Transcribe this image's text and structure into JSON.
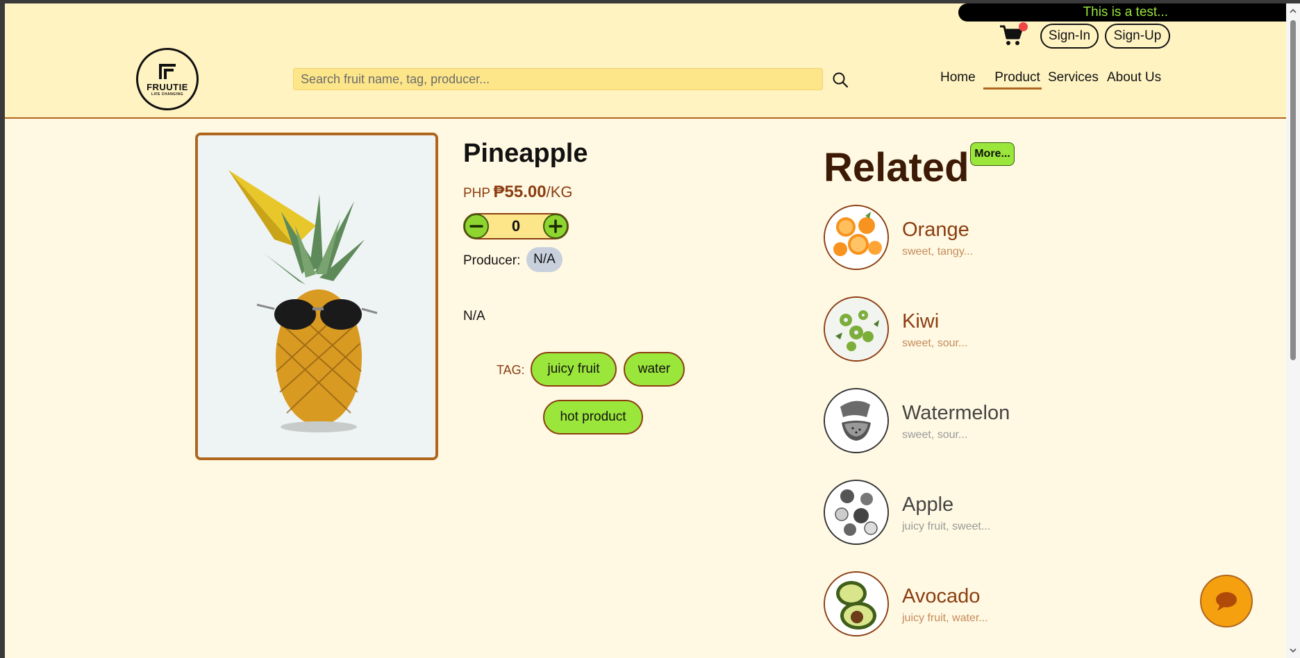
{
  "ticker": {
    "text": "This is a test..."
  },
  "header": {
    "signin_label": "Sign-In",
    "signup_label": "Sign-Up",
    "logo": {
      "name": "FRUUTIE",
      "tagline": "LIFE CHANGING"
    },
    "search": {
      "placeholder": "Search fruit name, tag, producer...",
      "value": ""
    },
    "nav": [
      {
        "label": "Home",
        "active": false
      },
      {
        "label": "Product",
        "active": true
      },
      {
        "label": "Services",
        "active": false
      },
      {
        "label": "About Us",
        "active": false
      }
    ]
  },
  "product": {
    "name": "Pineapple",
    "price_prefix": "PHP",
    "price": "₱55.00",
    "unit": "/KG",
    "quantity": "0",
    "producer_label": "Producer:",
    "producer": "N/A",
    "description": "N/A",
    "tag_label": "TAG:",
    "tags": [
      "juicy fruit",
      "water",
      "hot product"
    ]
  },
  "related": {
    "title": "Related",
    "more_label": "More...",
    "items": [
      {
        "name": "Orange",
        "tags": "sweet, tangy..."
      },
      {
        "name": "Kiwi",
        "tags": "sweet, sour..."
      },
      {
        "name": "Watermelon",
        "tags": "sweet, sour..."
      },
      {
        "name": "Apple",
        "tags": "juicy fruit, sweet..."
      },
      {
        "name": "Avocado",
        "tags": "juicy fruit, water..."
      }
    ]
  },
  "colors": {
    "header_bg": "#fff3c2",
    "page_bg": "#fff9e3",
    "accent_brown": "#8b3d10",
    "border_brown": "#b0651d",
    "tag_green": "#9ae63a",
    "search_bg": "#fde68a",
    "chat_orange": "#f5a00f"
  },
  "icons": [
    "cart-icon",
    "search-icon",
    "minus-icon",
    "plus-icon",
    "chat-icon"
  ]
}
